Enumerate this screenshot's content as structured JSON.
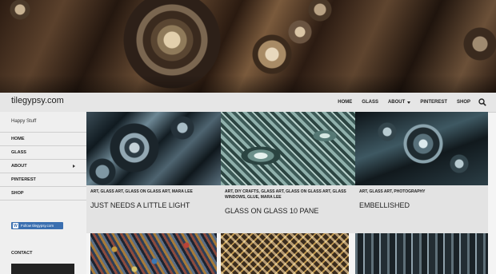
{
  "site": {
    "title": "tilegypsy.com",
    "tagline": "Happy Stuff"
  },
  "topnav": {
    "items": [
      {
        "label": "HOME"
      },
      {
        "label": "GLASS"
      },
      {
        "label": "ABOUT",
        "has_dropdown": true
      },
      {
        "label": "PINTEREST"
      },
      {
        "label": "SHOP"
      }
    ],
    "search_icon": "search-icon"
  },
  "sidebar": {
    "menu": [
      {
        "label": "HOME"
      },
      {
        "label": "GLASS"
      },
      {
        "label": "ABOUT",
        "has_submenu": true
      },
      {
        "label": "PINTEREST"
      },
      {
        "label": "SHOP"
      }
    ],
    "follow_button": "Follow tilegypsy.com",
    "contact_title": "CONTACT"
  },
  "posts": [
    {
      "categories": "ART, GLASS ART, GLASS ON GLASS ART, MARA LEE",
      "title": "JUST NEEDS A LITTLE LIGHT"
    },
    {
      "categories": "ART, DIY CRAFTS, GLASS ART, GLASS ON GLASS ART, GLASS WINDOWS, GLUE, MARA LEE",
      "title": "GLASS ON GLASS 10 PANE"
    },
    {
      "categories": "ART, GLASS ART, PHOTOGRAPHY",
      "title": "EMBELLISHED"
    }
  ],
  "colors": {
    "nav_bg": "#e6e6e6",
    "sidebar_bg": "#efefef",
    "follow_button": "#3a6fb0"
  }
}
